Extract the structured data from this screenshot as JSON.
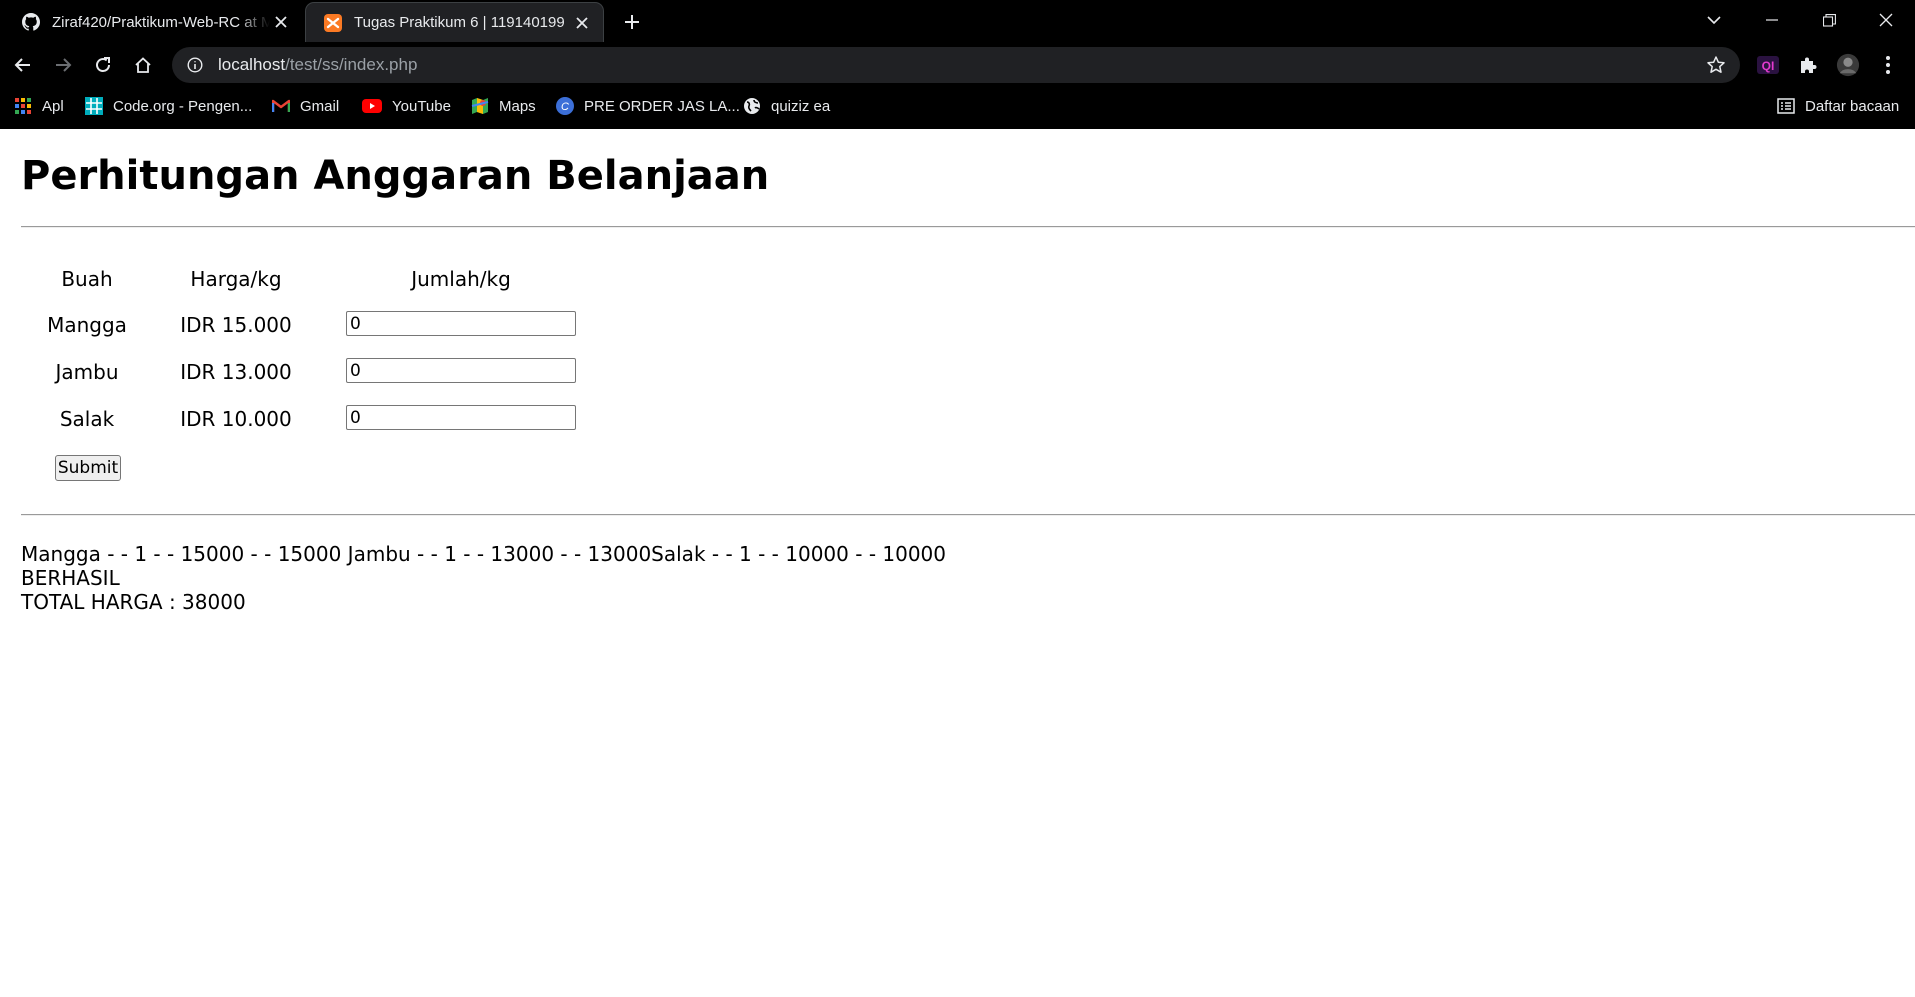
{
  "browser": {
    "tabs": [
      {
        "title": "Ziraf420/Praktikum-Web-RC at M",
        "favicon": "github-icon",
        "active": false
      },
      {
        "title": "Tugas Praktikum 6 | 119140199",
        "favicon": "xampp-icon",
        "active": true
      }
    ],
    "url": {
      "host": "localhost",
      "path": "/test/ss/index.php"
    },
    "bookmarks": [
      {
        "label": "Apl",
        "icon": "apps-grid-icon"
      },
      {
        "label": "Code.org - Pengen...",
        "icon": "code-org-icon"
      },
      {
        "label": "Gmail",
        "icon": "gmail-icon"
      },
      {
        "label": "YouTube",
        "icon": "youtube-icon"
      },
      {
        "label": "Maps",
        "icon": "maps-icon"
      },
      {
        "label": "PRE ORDER JAS LA...",
        "icon": "c-circle-icon"
      },
      {
        "label": "quiziz ea",
        "icon": "globe-icon"
      }
    ],
    "reading_list": "Daftar bacaan"
  },
  "page": {
    "title": "Perhitungan Anggaran Belanjaan",
    "table": {
      "headers": [
        "Buah",
        "Harga/kg",
        "Jumlah/kg"
      ],
      "rows": [
        {
          "fruit": "Mangga",
          "price": "IDR 15.000",
          "qty": "0"
        },
        {
          "fruit": "Jambu",
          "price": "IDR 13.000",
          "qty": "0"
        },
        {
          "fruit": "Salak",
          "price": "IDR 10.000",
          "qty": "0"
        }
      ]
    },
    "submit_label": "Submit",
    "result": {
      "line1": "Mangga - - 1 - - 15000 - - 15000 Jambu - - 1 - - 13000 - - 13000Salak - - 1 - - 10000 - - 10000",
      "line2": "BERHASIL",
      "line3": "TOTAL HARGA : 38000"
    }
  },
  "colors": {
    "chrome_bg": "#000000",
    "omnibox_bg": "#202124",
    "active_tab_bg": "#202124",
    "chrome_text": "#e8eaed"
  }
}
